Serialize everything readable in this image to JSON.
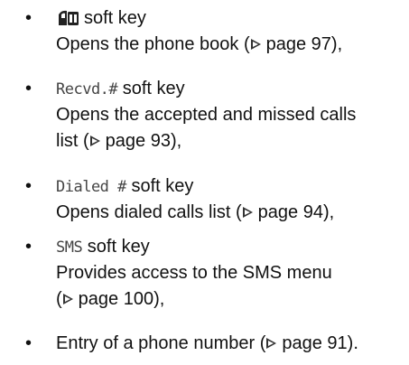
{
  "items": [
    {
      "key_icon": "phone-book-icon",
      "key_suffix": "soft key",
      "desc_pre": "Opens the phone book (",
      "page_ref": "page 97",
      "desc_post": "),"
    },
    {
      "key_label": "Recvd.#",
      "key_suffix": "soft key",
      "desc_line1": "Opens the accepted and missed calls",
      "desc_pre": "list (",
      "page_ref": "page 93",
      "desc_post": "),"
    },
    {
      "key_label": "Dialed #",
      "key_suffix": "soft key",
      "desc_pre": "Opens dialed calls list (",
      "page_ref": "page 94",
      "desc_post": "),"
    },
    {
      "key_label": "SMS",
      "key_suffix": "soft key",
      "desc_line1": "Provides access to the SMS menu",
      "desc_pre": "(",
      "page_ref": "page 100",
      "desc_post": "),"
    },
    {
      "desc_pre": "Entry of a phone number (",
      "page_ref": "page 91",
      "desc_post": ")."
    }
  ]
}
